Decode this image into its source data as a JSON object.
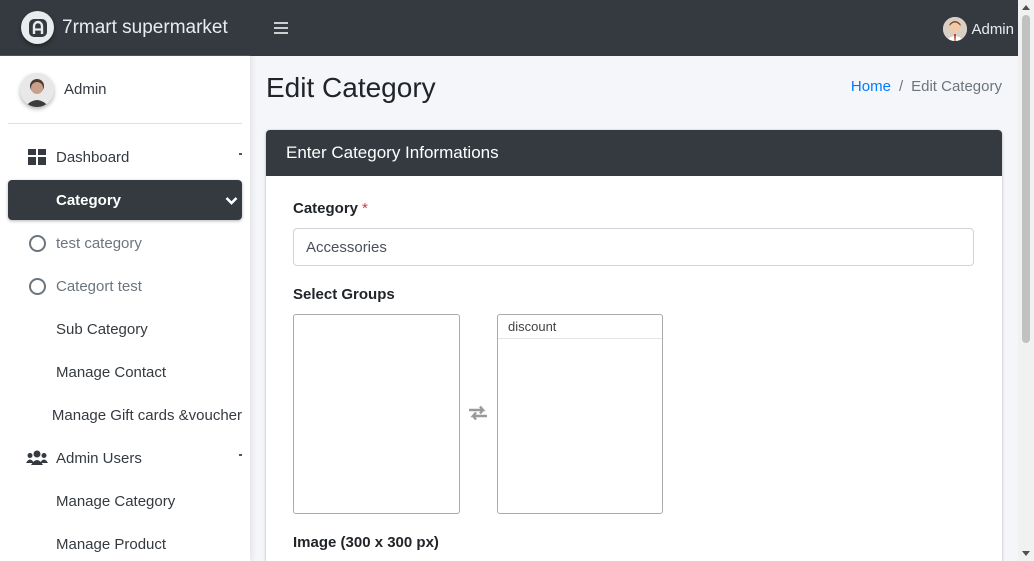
{
  "brand": {
    "name": "7rmart supermarket"
  },
  "sidebar": {
    "user": "Admin",
    "items": [
      {
        "label": "Dashboard",
        "icon": "dashboard-grid-icon"
      },
      {
        "label": "Category",
        "icon": "chevron-down-icon",
        "active": true
      },
      {
        "label": "test category",
        "icon": "circle-icon"
      },
      {
        "label": "Categort test",
        "icon": "circle-icon"
      },
      {
        "label": "Sub Category"
      },
      {
        "label": "Manage Contact"
      },
      {
        "label": "Manage Gift cards &voucher"
      },
      {
        "label": "Admin Users",
        "icon": "users-icon"
      },
      {
        "label": "Manage Category"
      },
      {
        "label": "Manage Product"
      }
    ]
  },
  "navbar": {
    "user": "Admin"
  },
  "page": {
    "title": "Edit Category",
    "breadcrumb": {
      "home": "Home",
      "separator": "/",
      "current": "Edit Category"
    }
  },
  "form": {
    "header": "Enter Category Informations",
    "category_label": "Category",
    "required_mark": "*",
    "category_value": "Accessories",
    "groups_label": "Select Groups",
    "available_groups": [],
    "selected_groups": [
      "discount"
    ],
    "image_label": "Image (300 x 300 px)"
  },
  "colors": {
    "dark": "#343a40",
    "link": "#007bff",
    "required": "#dc3545"
  }
}
